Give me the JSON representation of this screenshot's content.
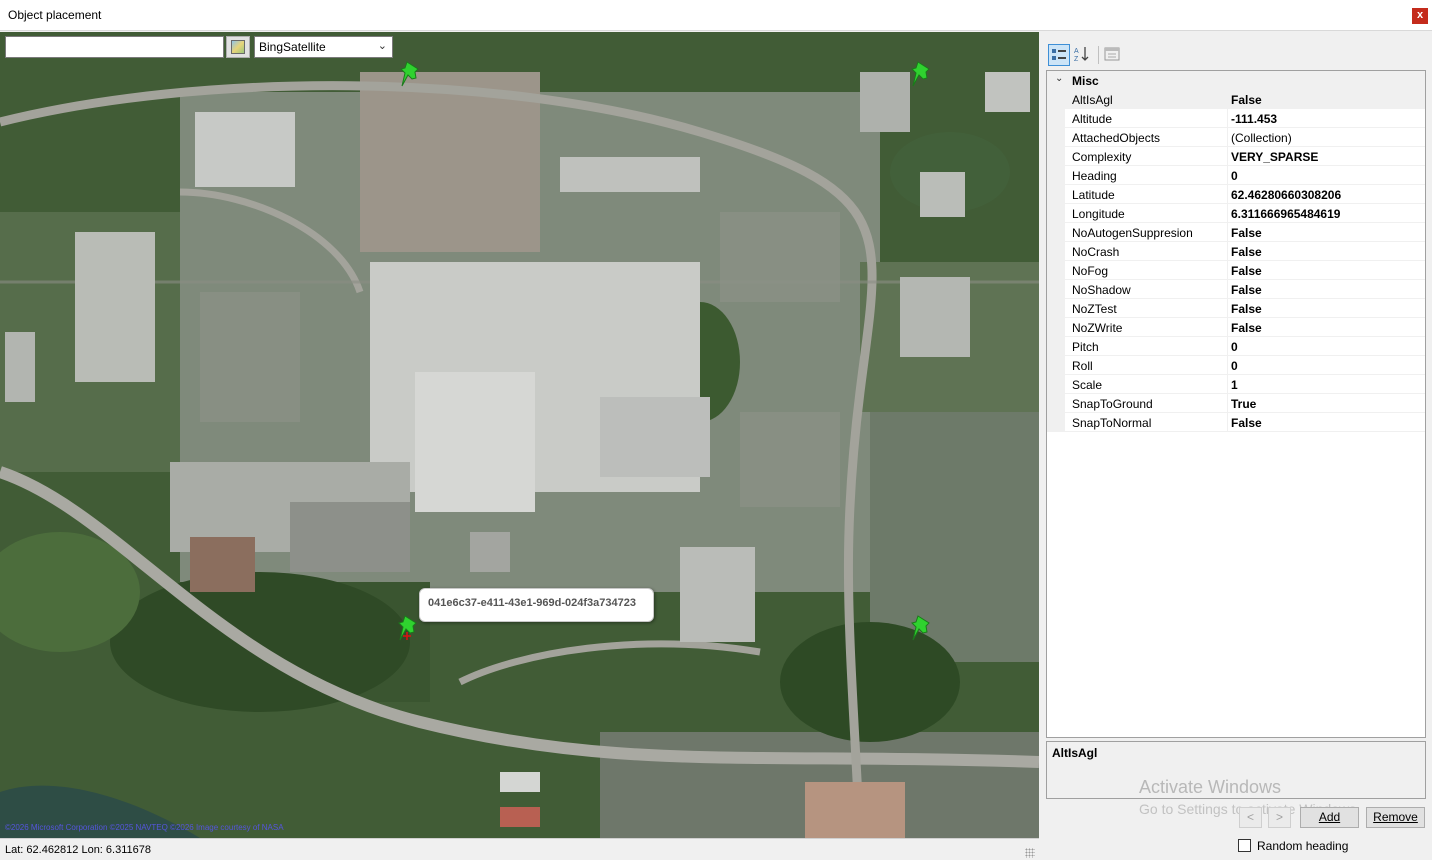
{
  "window": {
    "title": "Object placement",
    "close_glyph": "x"
  },
  "map": {
    "search": {
      "value": "",
      "placeholder": ""
    },
    "imagery_layer": "BingSatellite",
    "tooltip": "041e6c37-e411-43e1-969d-024f3a734723",
    "copyright": "©2026 Microsoft Corporation ©2025 NAVTEQ ©2026 Image courtesy of NASA",
    "pins": [
      {
        "name": "pin-north-west",
        "selected": false
      },
      {
        "name": "pin-north-east",
        "selected": false
      },
      {
        "name": "pin-selected-object",
        "selected": true
      },
      {
        "name": "pin-south-east",
        "selected": false
      }
    ]
  },
  "status": {
    "coords": "Lat: 62.462812 Lon: 6.311678"
  },
  "property_grid": {
    "toolbar": [
      "categorized-icon",
      "alphabetical-icon",
      "property-pages-icon"
    ],
    "category": "Misc",
    "rows": [
      {
        "name": "AltIsAgl",
        "value": "False",
        "bold": true,
        "selected": true
      },
      {
        "name": "Altitude",
        "value": "-111.453",
        "bold": true
      },
      {
        "name": "AttachedObjects",
        "value": "(Collection)",
        "bold": false
      },
      {
        "name": "Complexity",
        "value": "VERY_SPARSE",
        "bold": true
      },
      {
        "name": "Heading",
        "value": "0",
        "bold": true
      },
      {
        "name": "Latitude",
        "value": "62.46280660308206",
        "bold": true
      },
      {
        "name": "Longitude",
        "value": "6.311666965484619",
        "bold": true
      },
      {
        "name": "NoAutogenSuppresion",
        "value": "False",
        "bold": true
      },
      {
        "name": "NoCrash",
        "value": "False",
        "bold": true
      },
      {
        "name": "NoFog",
        "value": "False",
        "bold": true
      },
      {
        "name": "NoShadow",
        "value": "False",
        "bold": true
      },
      {
        "name": "NoZTest",
        "value": "False",
        "bold": true
      },
      {
        "name": "NoZWrite",
        "value": "False",
        "bold": true
      },
      {
        "name": "Pitch",
        "value": "0",
        "bold": true
      },
      {
        "name": "Roll",
        "value": "0",
        "bold": true
      },
      {
        "name": "Scale",
        "value": "1",
        "bold": true
      },
      {
        "name": "SnapToGround",
        "value": "True",
        "bold": true
      },
      {
        "name": "SnapToNormal",
        "value": "False",
        "bold": true
      }
    ],
    "description_title": "AltIsAgl"
  },
  "watermark": {
    "line1": "Activate Windows",
    "line2": "Go to Settings to activate Windows."
  },
  "buttons": {
    "prev": "<",
    "next": ">",
    "add": "Add",
    "remove": "Remove"
  },
  "random_heading": {
    "label": "Random heading",
    "checked": false
  },
  "colors": {
    "pin": "#2fd22f",
    "close": "#c42b1c",
    "selection": "#cce4f7"
  }
}
